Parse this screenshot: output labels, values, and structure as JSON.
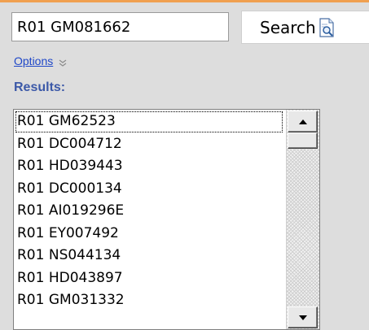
{
  "search": {
    "value": "R01 GM081662",
    "button_label": "Search"
  },
  "options": {
    "label": "Options"
  },
  "results": {
    "label": "Results:",
    "items": [
      "R01 GM62523",
      "R01 DC004712",
      "R01 HD039443",
      "R01 DC000134",
      "R01 AI019296E",
      "R01 EY007492",
      "R01 NS044134",
      "R01 HD043897",
      "R01 GM031332"
    ],
    "selected_index": 0
  },
  "icons": {
    "search_button_icon": "magnifier-document-icon",
    "options_toggle_icon": "double-chevron-down-icon",
    "scroll_up_icon": "triangle-up-icon",
    "scroll_down_icon": "triangle-down-icon"
  },
  "colors": {
    "top_border": "#f0a050",
    "link": "#1f47c8",
    "results_label": "#3c59a8"
  }
}
